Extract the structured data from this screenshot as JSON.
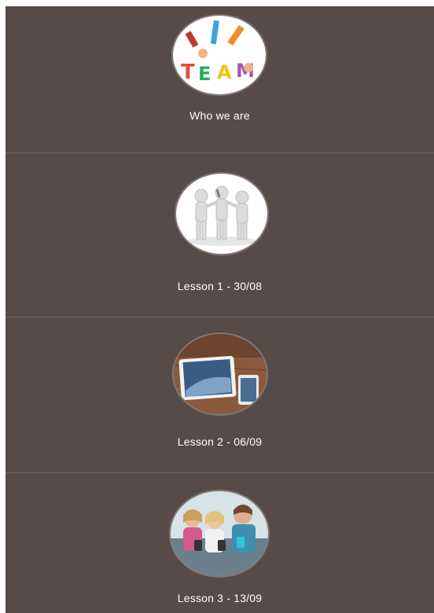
{
  "cards": [
    {
      "label": "Who we are",
      "image": "team-craft-image"
    },
    {
      "label": "Lesson 1 - 30/08",
      "image": "teamwork-figures-image"
    },
    {
      "label": "Lesson 2 - 06/09",
      "image": "tablet-phone-image"
    },
    {
      "label": "Lesson 3 - 13/09",
      "image": "kids-with-phones-image"
    }
  ],
  "colors": {
    "background": "#564b48",
    "divider": "#6d6360",
    "text": "#ffffff"
  }
}
